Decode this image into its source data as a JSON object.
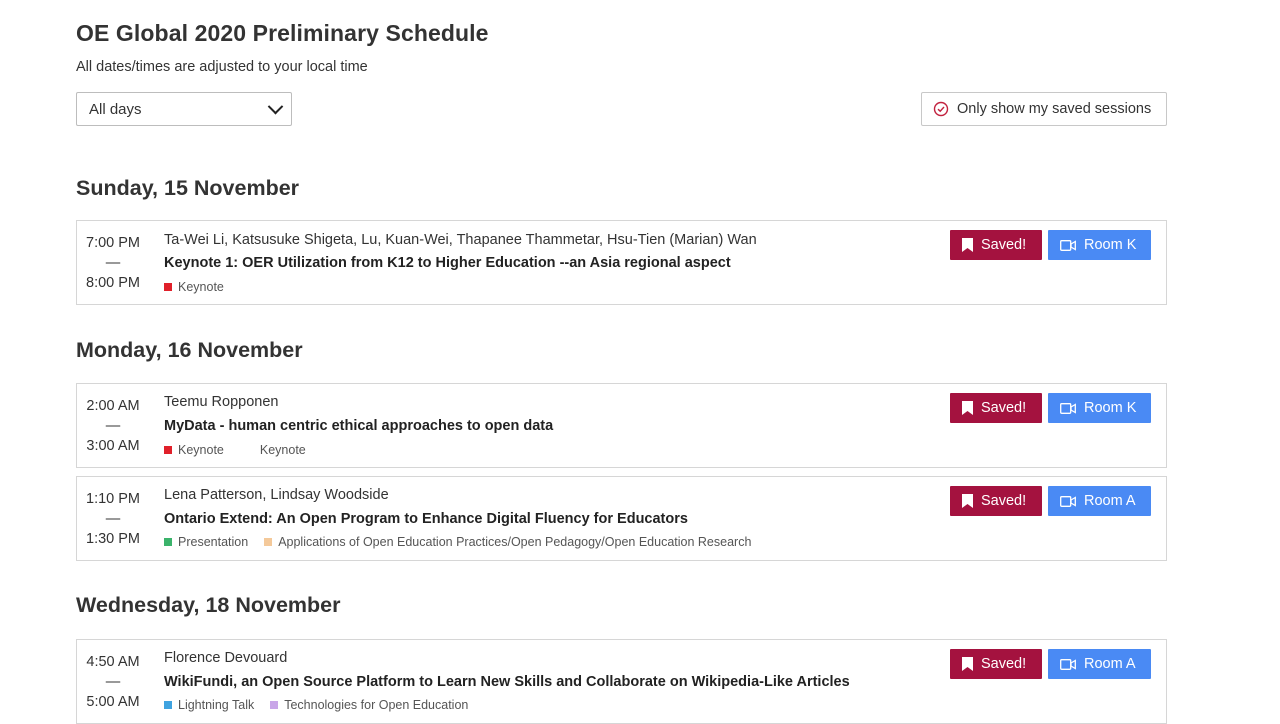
{
  "header": {
    "title": "OE Global 2020 Preliminary Schedule",
    "subtitle": "All dates/times are adjusted to your local time"
  },
  "filters": {
    "day_select_value": "All days",
    "saved_toggle_label": "Only show my saved sessions"
  },
  "colors": {
    "saved_button": "#a4123f",
    "room_button": "#4a8af4",
    "keynote_tag": "#e0202a",
    "presentation_tag": "#3bb36b",
    "applications_tag": "#f4c99a",
    "lightning_tag": "#3fa3e0",
    "technologies_tag": "#c9a6e8"
  },
  "days": [
    {
      "heading": "Sunday, 15 November",
      "sessions": [
        {
          "start": "7:00 PM",
          "dash": "—",
          "end": "8:00 PM",
          "speakers": "Ta-Wei Li, Katsusuke Shigeta, Lu, Kuan-Wei, Thapanee Thammetar, Hsu-Tien (Marian) Wan",
          "title": "Keynote 1: OER Utilization from K12 to Higher Education --an Asia regional aspect",
          "tags": [
            {
              "label": "Keynote",
              "color_key": "keynote_tag"
            }
          ],
          "saved_label": "Saved!",
          "room": "Room K"
        }
      ]
    },
    {
      "heading": "Monday, 16 November",
      "sessions": [
        {
          "start": "2:00 AM",
          "dash": "—",
          "end": "3:00 AM",
          "speakers": "Teemu Ropponen",
          "title": "MyData - human centric ethical approaches to open data",
          "tags": [
            {
              "label": "Keynote",
              "color_key": "keynote_tag"
            },
            {
              "label": "Keynote",
              "color_key": ""
            }
          ],
          "saved_label": "Saved!",
          "room": "Room K"
        },
        {
          "start": "1:10 PM",
          "dash": "—",
          "end": "1:30 PM",
          "speakers": "Lena Patterson, Lindsay Woodside",
          "title": "Ontario Extend: An Open Program to Enhance Digital Fluency for Educators",
          "tags": [
            {
              "label": "Presentation",
              "color_key": "presentation_tag"
            },
            {
              "label": "Applications of Open Education Practices/Open Pedagogy/Open Education Research",
              "color_key": "applications_tag"
            }
          ],
          "saved_label": "Saved!",
          "room": "Room A"
        }
      ]
    },
    {
      "heading": "Wednesday, 18 November",
      "sessions": [
        {
          "start": "4:50 AM",
          "dash": "—",
          "end": "5:00 AM",
          "speakers": "Florence Devouard",
          "title": "WikiFundi, an Open Source Platform to Learn New Skills and Collaborate on Wikipedia-Like Articles",
          "tags": [
            {
              "label": "Lightning Talk",
              "color_key": "lightning_tag"
            },
            {
              "label": "Technologies for Open Education",
              "color_key": "technologies_tag"
            }
          ],
          "saved_label": "Saved!",
          "room": "Room A"
        }
      ]
    }
  ]
}
